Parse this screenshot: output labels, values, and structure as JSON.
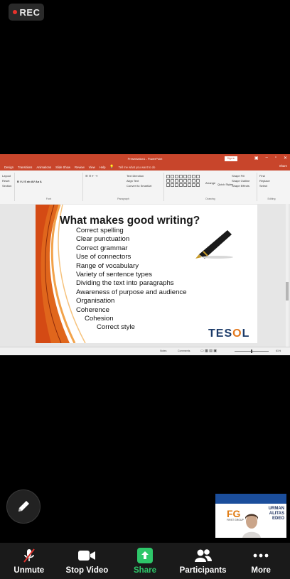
{
  "recording": {
    "label": "REC",
    "indicator_color": "#e8322c"
  },
  "powerpoint": {
    "title": "Presentation1 - PowerPoint",
    "sign_in": "Sign in",
    "share": "Share",
    "tabs": [
      "Design",
      "Transitions",
      "Animations",
      "Slide Show",
      "Review",
      "View",
      "Help"
    ],
    "tell_me": "Tell me what you want to do",
    "ribbon": {
      "slides_items": [
        "Layout",
        "Reset",
        "Section"
      ],
      "font_label": "Font",
      "paragraph_label": "Paragraph",
      "text_direction": "Text Direction",
      "align_text": "Align Text",
      "convert_smartart": "Convert to SmartArt",
      "drawing_label": "Drawing",
      "arrange": "Arrange",
      "quick_styles": "Quick Styles",
      "shape_fill": "Shape Fill",
      "shape_outline": "Shape Outline",
      "shape_effects": "Shape Effects",
      "find": "Find",
      "replace": "Replace",
      "select": "Select",
      "editing_label": "Editing"
    },
    "slide": {
      "title": "What makes good writing?",
      "bullets": [
        {
          "text": "Correct spelling",
          "level": 0
        },
        {
          "text": "Clear punctuation",
          "level": 0
        },
        {
          "text": "Correct grammar",
          "level": 0
        },
        {
          "text": "Use of connectors",
          "level": 0
        },
        {
          "text": "Range of vocabulary",
          "level": 0
        },
        {
          "text": "Variety of sentence types",
          "level": 0
        },
        {
          "text": "Dividing the text into paragraphs",
          "level": 0
        },
        {
          "text": "Awareness of purpose and audience",
          "level": 0
        },
        {
          "text": "Organisation",
          "level": 0
        },
        {
          "text": "Coherence",
          "level": 0
        },
        {
          "text": "Cohesion",
          "level": 1
        },
        {
          "text": "Correct style",
          "level": 2
        }
      ],
      "logo": {
        "prefix": "TES",
        "o": "O",
        "suffix": "L",
        "color": "#1b3a68",
        "accent": "#e4781c"
      }
    },
    "status": {
      "notes": "Notes",
      "comments": "Comments",
      "zoom": "61%"
    }
  },
  "video": {
    "banner_text": "FG",
    "subtitle": "FIRST GROUP",
    "right_lines": [
      "URMAN",
      "ALITAS",
      "EDEO"
    ]
  },
  "toolbar": {
    "items": [
      {
        "label": "Unmute",
        "icon": "muted-mic-icon"
      },
      {
        "label": "Stop Video",
        "icon": "video-camera-icon"
      },
      {
        "label": "Share",
        "icon": "share-screen-icon",
        "color": "#2ec76a"
      },
      {
        "label": "Participants",
        "icon": "participants-icon"
      },
      {
        "label": "More",
        "icon": "more-icon"
      }
    ]
  }
}
